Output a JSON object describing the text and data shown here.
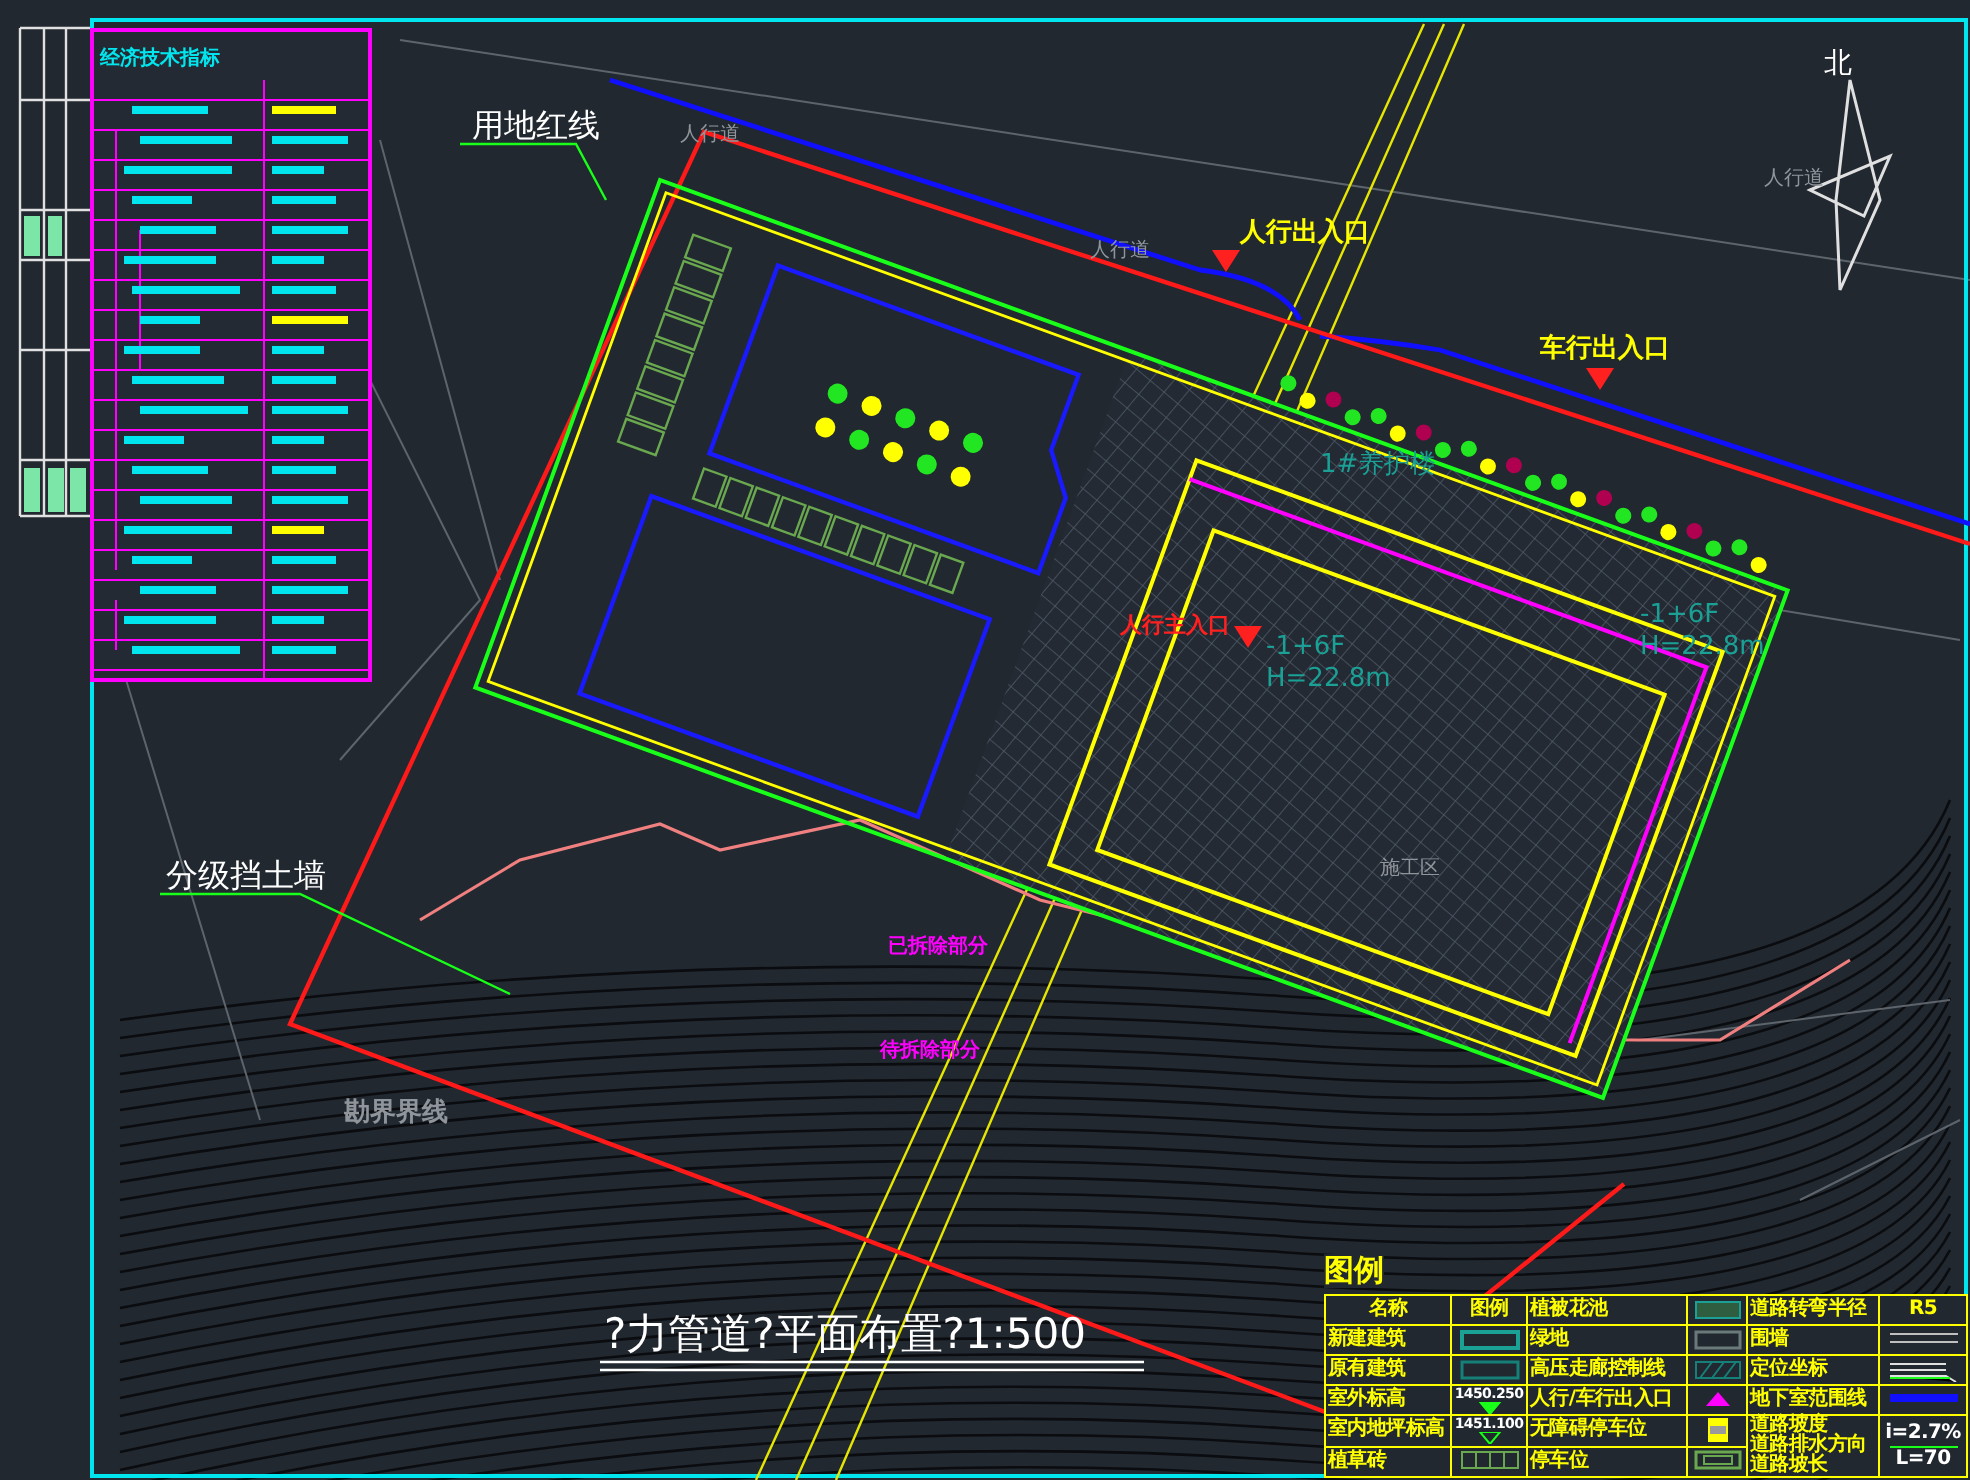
{
  "title": "?力管道?平面布置?1:500",
  "north_label": "北",
  "indicators_table": {
    "title": "经济技术指标"
  },
  "annotations": [
    {
      "text": "用地红线",
      "kind": "callout"
    },
    {
      "text": "分级挡土墙",
      "kind": "callout"
    },
    {
      "text": "勘界界线",
      "kind": "boundary"
    },
    {
      "text": "人行出入口",
      "kind": "entrance"
    },
    {
      "text": "车行出入口",
      "kind": "entrance"
    },
    {
      "text": "人行主入口",
      "kind": "main-entrance"
    },
    {
      "text": "1#养护楼",
      "kind": "building"
    },
    {
      "text": "-1+6F",
      "kind": "building"
    },
    {
      "text": "H=22.8m",
      "kind": "building"
    },
    {
      "text": "施工区",
      "kind": "area"
    },
    {
      "text": "人行道",
      "kind": "road"
    },
    {
      "text": "人行道",
      "kind": "road"
    },
    {
      "text": "人行道",
      "kind": "road"
    },
    {
      "text": "已拆除部分",
      "kind": "demolition"
    },
    {
      "text": "待拆除部分",
      "kind": "demolition"
    },
    {
      "text": "-1+6F",
      "kind": "building"
    },
    {
      "text": "H=22.8m",
      "kind": "building"
    }
  ],
  "legend": {
    "title": "图例",
    "header": [
      "名称",
      "图例"
    ],
    "groups": [
      [
        {
          "name": "新建建筑",
          "kind": "new-building"
        },
        {
          "name": "原有建筑",
          "kind": "existing-building"
        },
        {
          "name": "室外标高",
          "kind": "outdoor-elevation",
          "value": "1450.250"
        },
        {
          "name": "室内地坪标高",
          "kind": "indoor-elevation",
          "value": "1451.100"
        },
        {
          "name": "植草砖",
          "kind": "grass-paver"
        }
      ],
      [
        {
          "name": "植被花池",
          "kind": "planter"
        },
        {
          "name": "绿地",
          "kind": "lawn"
        },
        {
          "name": "高压走廊控制线",
          "kind": "hatch"
        },
        {
          "name": "人行/车行出入口",
          "kind": "entrance"
        },
        {
          "name": "无障碍停车位",
          "kind": "accessible-parking"
        },
        {
          "name": "停车位",
          "kind": "parking"
        }
      ],
      [
        {
          "name": "道路转弯半径",
          "kind": "text",
          "value": "R5"
        },
        {
          "name": "围墙",
          "kind": "wall"
        },
        {
          "name": "定位坐标",
          "kind": "coordinate"
        },
        {
          "name": "地下室范围线",
          "kind": "basement-line"
        },
        {
          "names": [
            "道路坡度",
            "道路排水方向",
            "道路坡长"
          ],
          "kind": "slope",
          "slope": "i=2.7%",
          "length": "L=70"
        }
      ]
    ]
  }
}
